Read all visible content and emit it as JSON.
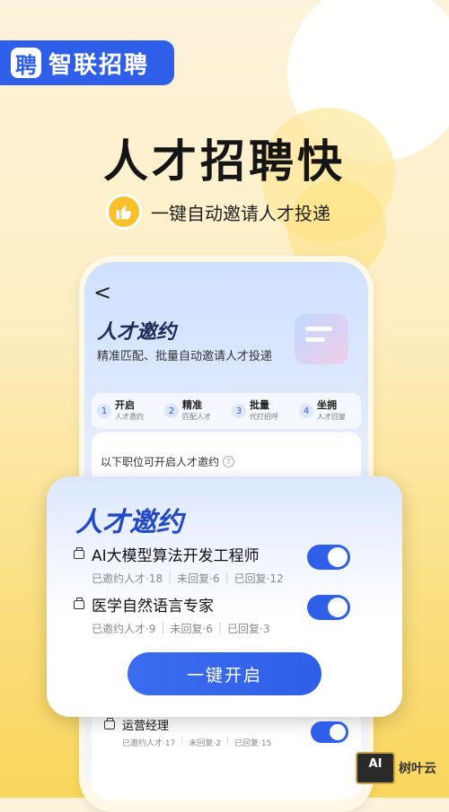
{
  "brand": {
    "logo_glyph": "聘",
    "name": "智联招聘",
    "color": "#2f5fe8"
  },
  "hero": {
    "headline": "人才招聘快",
    "subline": "一键自动邀请人才投递",
    "thumb_icon": "thumbs-up-icon"
  },
  "phone": {
    "back_icon": "chevron-left-icon",
    "back_glyph": "<",
    "title": "人才邀约",
    "desc": "精准匹配、批量自动邀请人才投递",
    "steps": [
      {
        "num": "1",
        "title": "开启",
        "sub": "人才邀约"
      },
      {
        "num": "2",
        "title": "精准",
        "sub": "匹配人才"
      },
      {
        "num": "3",
        "title": "批量",
        "sub": "代打招呼"
      },
      {
        "num": "4",
        "title": "坐拥",
        "sub": "人才回复"
      }
    ],
    "list_header": "以下职位可开启人才邀约",
    "help_glyph": "?"
  },
  "card": {
    "title": "人才邀约",
    "jobs": [
      {
        "title": "AI大模型算法开发工程师",
        "invited": "已邀约人才·18",
        "unreplied": "未回复·6",
        "replied": "已回复·12",
        "enabled": true
      },
      {
        "title": "医学自然语言专家",
        "invited": "已邀约人才·9",
        "unreplied": "未回复·6",
        "replied": "已回复·3",
        "enabled": true
      }
    ],
    "cta": "一键开启"
  },
  "bottom_job": {
    "title": "运营经理",
    "invited": "已邀约人才·17",
    "unreplied": "未回复·2",
    "replied": "已回复·15",
    "enabled": true
  },
  "watermark": {
    "icon_text": "AI",
    "text": "树叶云"
  }
}
